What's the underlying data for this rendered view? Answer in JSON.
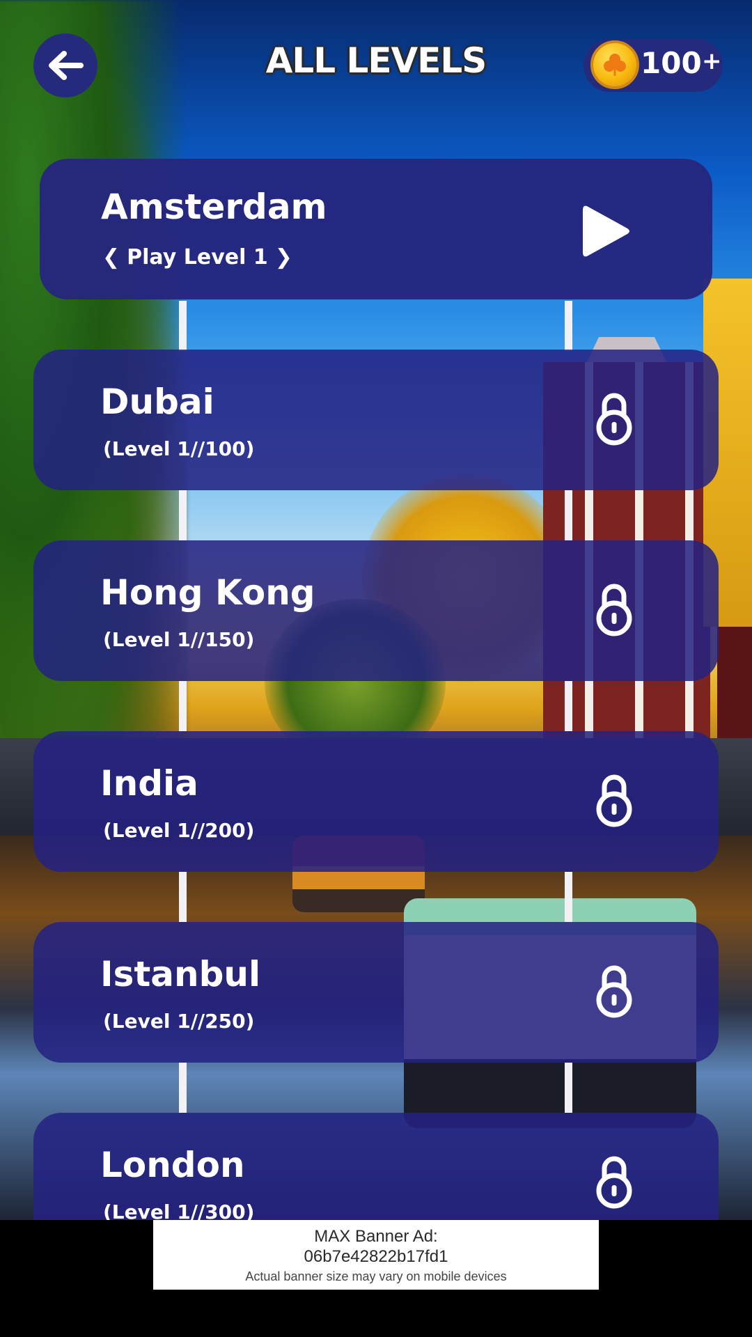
{
  "header": {
    "title": "ALL LEVELS",
    "coins": "100",
    "coins_plus": "+"
  },
  "levels": [
    {
      "name": "Amsterdam",
      "subtitle": "Play Level 1",
      "status": "unlocked"
    },
    {
      "name": "Dubai",
      "subtitle": "(Level 1//100)",
      "status": "locked"
    },
    {
      "name": "Hong Kong",
      "subtitle": "(Level 1//150)",
      "status": "locked"
    },
    {
      "name": "India",
      "subtitle": "(Level 1//200)",
      "status": "locked"
    },
    {
      "name": "Istanbul",
      "subtitle": "(Level 1//250)",
      "status": "locked"
    },
    {
      "name": "London",
      "subtitle": "(Level 1//300)",
      "status": "locked"
    }
  ],
  "ad": {
    "line1": "MAX Banner Ad:",
    "line2": "06b7e42822b17fd1",
    "line3": "Actual banner size may vary on mobile devices"
  },
  "icons": {
    "back": "arrow-left-icon",
    "coin": "clover-coin-icon",
    "play": "play-icon",
    "lock": "padlock-icon"
  },
  "colors": {
    "card": "#24228a",
    "header_pill": "#262a7c",
    "coin": "#f8b90e",
    "connector": "#f2f2f6"
  }
}
